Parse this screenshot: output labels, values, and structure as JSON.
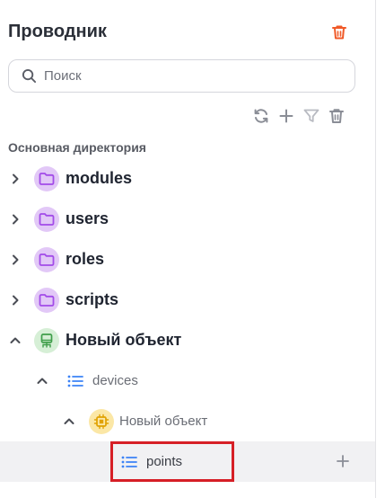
{
  "explorer": {
    "title": "Проводник",
    "search_placeholder": "Поиск",
    "section_label": "Основная директория",
    "tree": {
      "modules": "modules",
      "users": "users",
      "roles": "roles",
      "scripts": "scripts",
      "new_object": "Новый объект",
      "devices": "devices",
      "nested_object": "Новый объект",
      "points": "points"
    }
  },
  "colors": {
    "accent_orange": "#f05a28",
    "folder_bg": "#e2c8f7",
    "folder_icon": "#a24be8",
    "device_bg": "#d6efd6",
    "device_icon": "#3f9e4a",
    "chip_bg": "#fbe7a6",
    "chip_icon": "#e0a100",
    "list_icon": "#3b82f6",
    "selection_outline": "#d61f26"
  },
  "icons": {
    "top_right": "trash-icon",
    "toolbar": [
      "refresh-icon",
      "plus-icon",
      "filter-icon",
      "trash-icon"
    ],
    "search": "search-icon"
  }
}
